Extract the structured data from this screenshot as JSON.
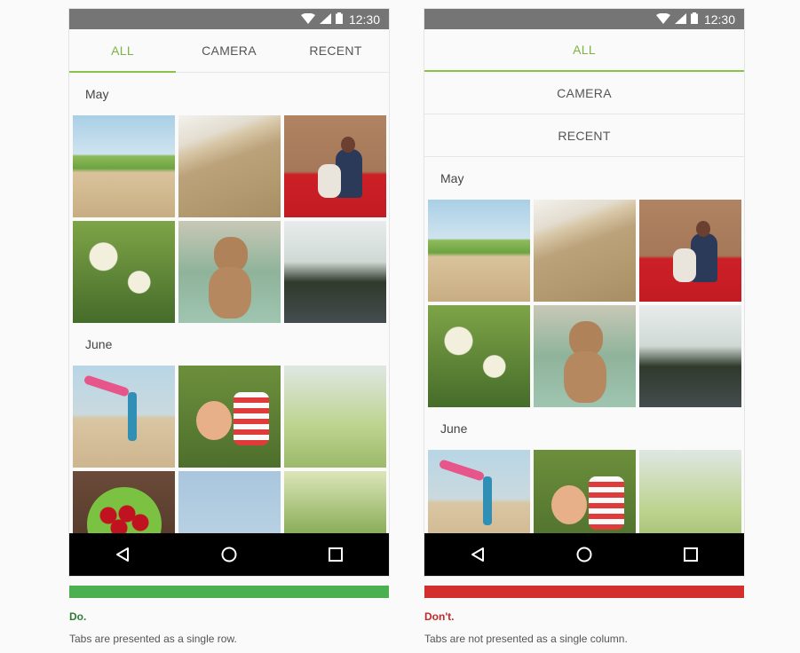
{
  "status_bar": {
    "time": "12:30"
  },
  "tabs": [
    "ALL",
    "CAMERA",
    "RECENT"
  ],
  "sections": [
    {
      "label": "May",
      "photos": [
        "beach-path",
        "waves",
        "mother-child-couch",
        "white-flowers",
        "dog",
        "street-trees"
      ]
    },
    {
      "label": "June",
      "photos": [
        "girl-scarf-beach",
        "child-lying-grass",
        "flowering-bush",
        "cherries-bowl",
        "tree-sky",
        "grass-blades"
      ]
    }
  ],
  "nav_icons": [
    "back-icon",
    "home-icon",
    "recents-icon"
  ],
  "do": {
    "bar_color": "#4caf50",
    "title": "Do.",
    "title_color": "#2e7d32",
    "text": "Tabs are presented as a single row."
  },
  "dont": {
    "bar_color": "#d32f2f",
    "title": "Don't.",
    "title_color": "#c62828",
    "text": "Tabs are not presented as a single column."
  },
  "accent": "#8bc34a"
}
